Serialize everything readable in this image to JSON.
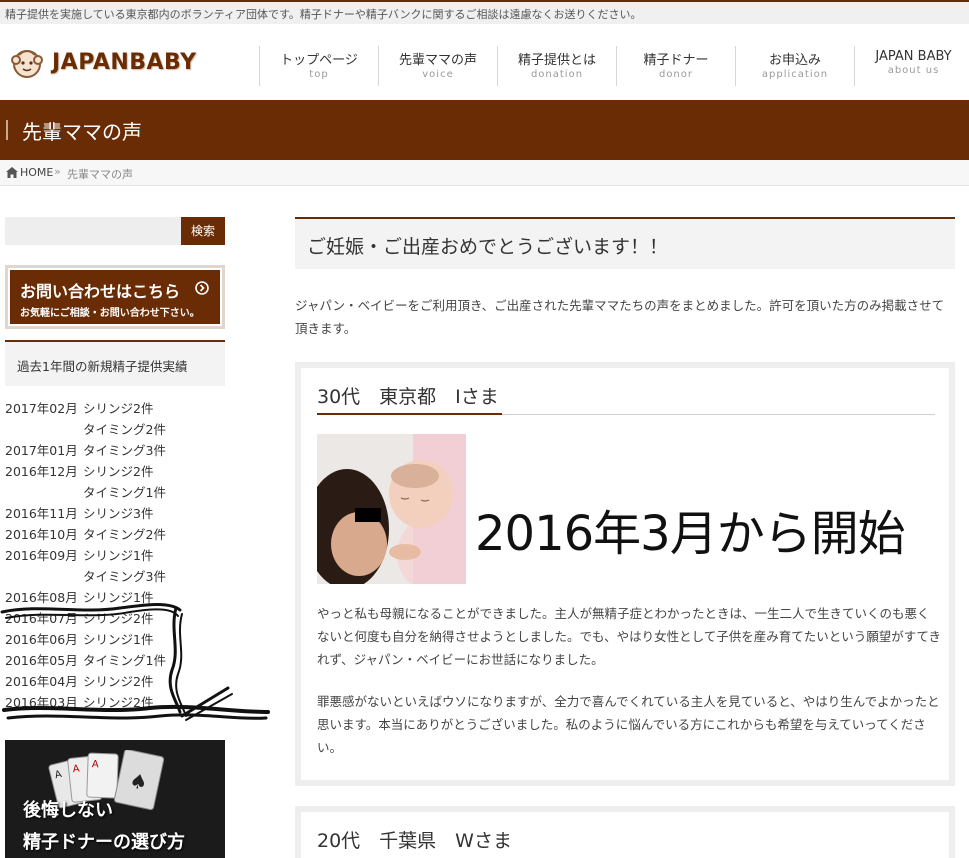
{
  "notice": "精子提供を実施している東京都内のボランティア団体です。精子ドナーや精子バンクに関するご相談は遠慮なくお送りください。",
  "brand": "JAPANBABY",
  "nav": [
    {
      "ja": "トップページ",
      "en": "top"
    },
    {
      "ja": "先輩ママの声",
      "en": "voice"
    },
    {
      "ja": "精子提供とは",
      "en": "donation"
    },
    {
      "ja": "精子ドナー",
      "en": "donor"
    },
    {
      "ja": "お申込み",
      "en": "application"
    },
    {
      "ja": "JAPAN BABY",
      "en": "about us"
    }
  ],
  "page_title": "先輩ママの声",
  "breadcrumb": {
    "home": "HOME",
    "sep": "»",
    "current": "先輩ママの声"
  },
  "sidebar": {
    "search_button": "検索",
    "contact_banner": {
      "title": "お問い合わせはこちら",
      "subtitle": "お気軽にご相談・お問い合わせ下さい。"
    },
    "records_title": "過去1年間の新規精子提供実績",
    "records": [
      {
        "date": "2017年02月",
        "item": "シリンジ2件"
      },
      {
        "date": "",
        "item": "タイミング2件"
      },
      {
        "date": "2017年01月",
        "item": "タイミング3件"
      },
      {
        "date": "2016年12月",
        "item": "シリンジ2件"
      },
      {
        "date": "",
        "item": "タイミング1件"
      },
      {
        "date": "2016年11月",
        "item": "シリンジ3件"
      },
      {
        "date": "2016年10月",
        "item": "タイミング2件"
      },
      {
        "date": "2016年09月",
        "item": "シリンジ1件"
      },
      {
        "date": "",
        "item": "タイミング3件"
      },
      {
        "date": "2016年08月",
        "item": "シリンジ1件"
      },
      {
        "date": "2016年07月",
        "item": "シリンジ2件"
      },
      {
        "date": "2016年06月",
        "item": "シリンジ1件"
      },
      {
        "date": "2016年05月",
        "item": "タイミング1件"
      },
      {
        "date": "2016年04月",
        "item": "シリンジ2件"
      },
      {
        "date": "2016年03月",
        "item": "シリンジ2件"
      }
    ],
    "ad_banner": {
      "line1": "後悔しない",
      "line2": "精子ドナーの選び方"
    }
  },
  "main": {
    "title": "ご妊娠・ご出産おめでとうございます！！",
    "intro": "ジャパン・ベイビーをご利用頂き、ご出産された先輩ママたちの声をまとめました。許可を頂いた方のみ掲載させて頂きます。",
    "testimonials": [
      {
        "heading": "30代　東京都　Iさま",
        "headline": "2016年3月から開始",
        "p1": "やっと私も母親になることができました。主人が無精子症とわかったときは、一生二人で生きていくのも悪くないと何度も自分を納得させようとしました。でも、やはり女性として子供を産み育てたいという願望がすてきれず、ジャパン・ベイビーにお世話になりました。",
        "p2": "罪悪感がないといえばウソになりますが、全力で喜んでくれている主人を見ていると、やはり生んでよかったと思います。本当にありがとうございました。私のように悩んでいる方にこれからも希望を与えていってください。"
      },
      {
        "heading": "20代　千葉県　Wさま"
      }
    ]
  },
  "colors": {
    "accent": "#6a2c05",
    "panel": "#f3f3f3"
  }
}
